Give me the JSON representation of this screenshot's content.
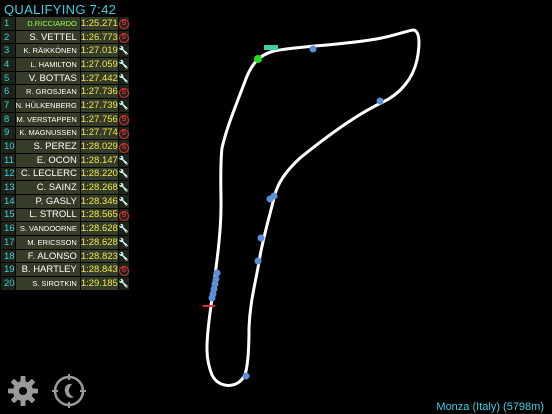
{
  "header": {
    "session_label": "QUALIFYING 7:42"
  },
  "footer": {
    "track_label": "Monza (Italy)  (5798m)"
  },
  "colors": {
    "accent": "#3fd0e6",
    "lap_time": "#f0e84a",
    "leader": "#9cff4a",
    "car_dot": "#5b8fd6",
    "track": "#ffffff"
  },
  "icons": {
    "settings": "gear-icon",
    "logo": "b-logo-icon",
    "pit_status": "s-circle-icon",
    "setup_status": "wrench-icon"
  },
  "standings": [
    {
      "pos": "1",
      "driver": "D.RICCIARDO",
      "time": "1:25.271",
      "status": "S"
    },
    {
      "pos": "2",
      "driver": "S. VETTEL",
      "time": "1:26.773",
      "status": "S"
    },
    {
      "pos": "3",
      "driver": "K. RÄIKKÖNEN",
      "time": "1:27.019",
      "status": "W"
    },
    {
      "pos": "4",
      "driver": "L. HAMILTON",
      "time": "1:27.059",
      "status": "W"
    },
    {
      "pos": "5",
      "driver": "V. BOTTAS",
      "time": "1:27.442",
      "status": "W"
    },
    {
      "pos": "6",
      "driver": "R. GROSJEAN",
      "time": "1:27.736",
      "status": "S"
    },
    {
      "pos": "7",
      "driver": "N. HÜLKENBERG",
      "time": "1:27.739",
      "status": "W"
    },
    {
      "pos": "8",
      "driver": "M. VERSTAPPEN",
      "time": "1:27.756",
      "status": "S"
    },
    {
      "pos": "9",
      "driver": "K. MAGNUSSEN",
      "time": "1:27.774",
      "status": "S"
    },
    {
      "pos": "10",
      "driver": "S. PEREZ",
      "time": "1:28.029",
      "status": "S"
    },
    {
      "pos": "11",
      "driver": "E. OCON",
      "time": "1:28.147",
      "status": "W"
    },
    {
      "pos": "12",
      "driver": "C. LECLERC",
      "time": "1:28.220",
      "status": "W"
    },
    {
      "pos": "13",
      "driver": "C. SAINZ",
      "time": "1:28.268",
      "status": "W"
    },
    {
      "pos": "14",
      "driver": "P. GASLY",
      "time": "1:28.346",
      "status": "W"
    },
    {
      "pos": "15",
      "driver": "L. STROLL",
      "time": "1:28.565",
      "status": "S"
    },
    {
      "pos": "16",
      "driver": "S. VANDOORNE",
      "time": "1:28.628",
      "status": "W"
    },
    {
      "pos": "17",
      "driver": "M. ERICSSON",
      "time": "1:28.628",
      "status": "W"
    },
    {
      "pos": "18",
      "driver": "F. ALONSO",
      "time": "1:28.823",
      "status": "W"
    },
    {
      "pos": "19",
      "driver": "B. HARTLEY",
      "time": "1:28.843",
      "status": "S"
    },
    {
      "pos": "20",
      "driver": "S. SIROTKIN",
      "time": "1:29.185",
      "status": "W"
    }
  ]
}
